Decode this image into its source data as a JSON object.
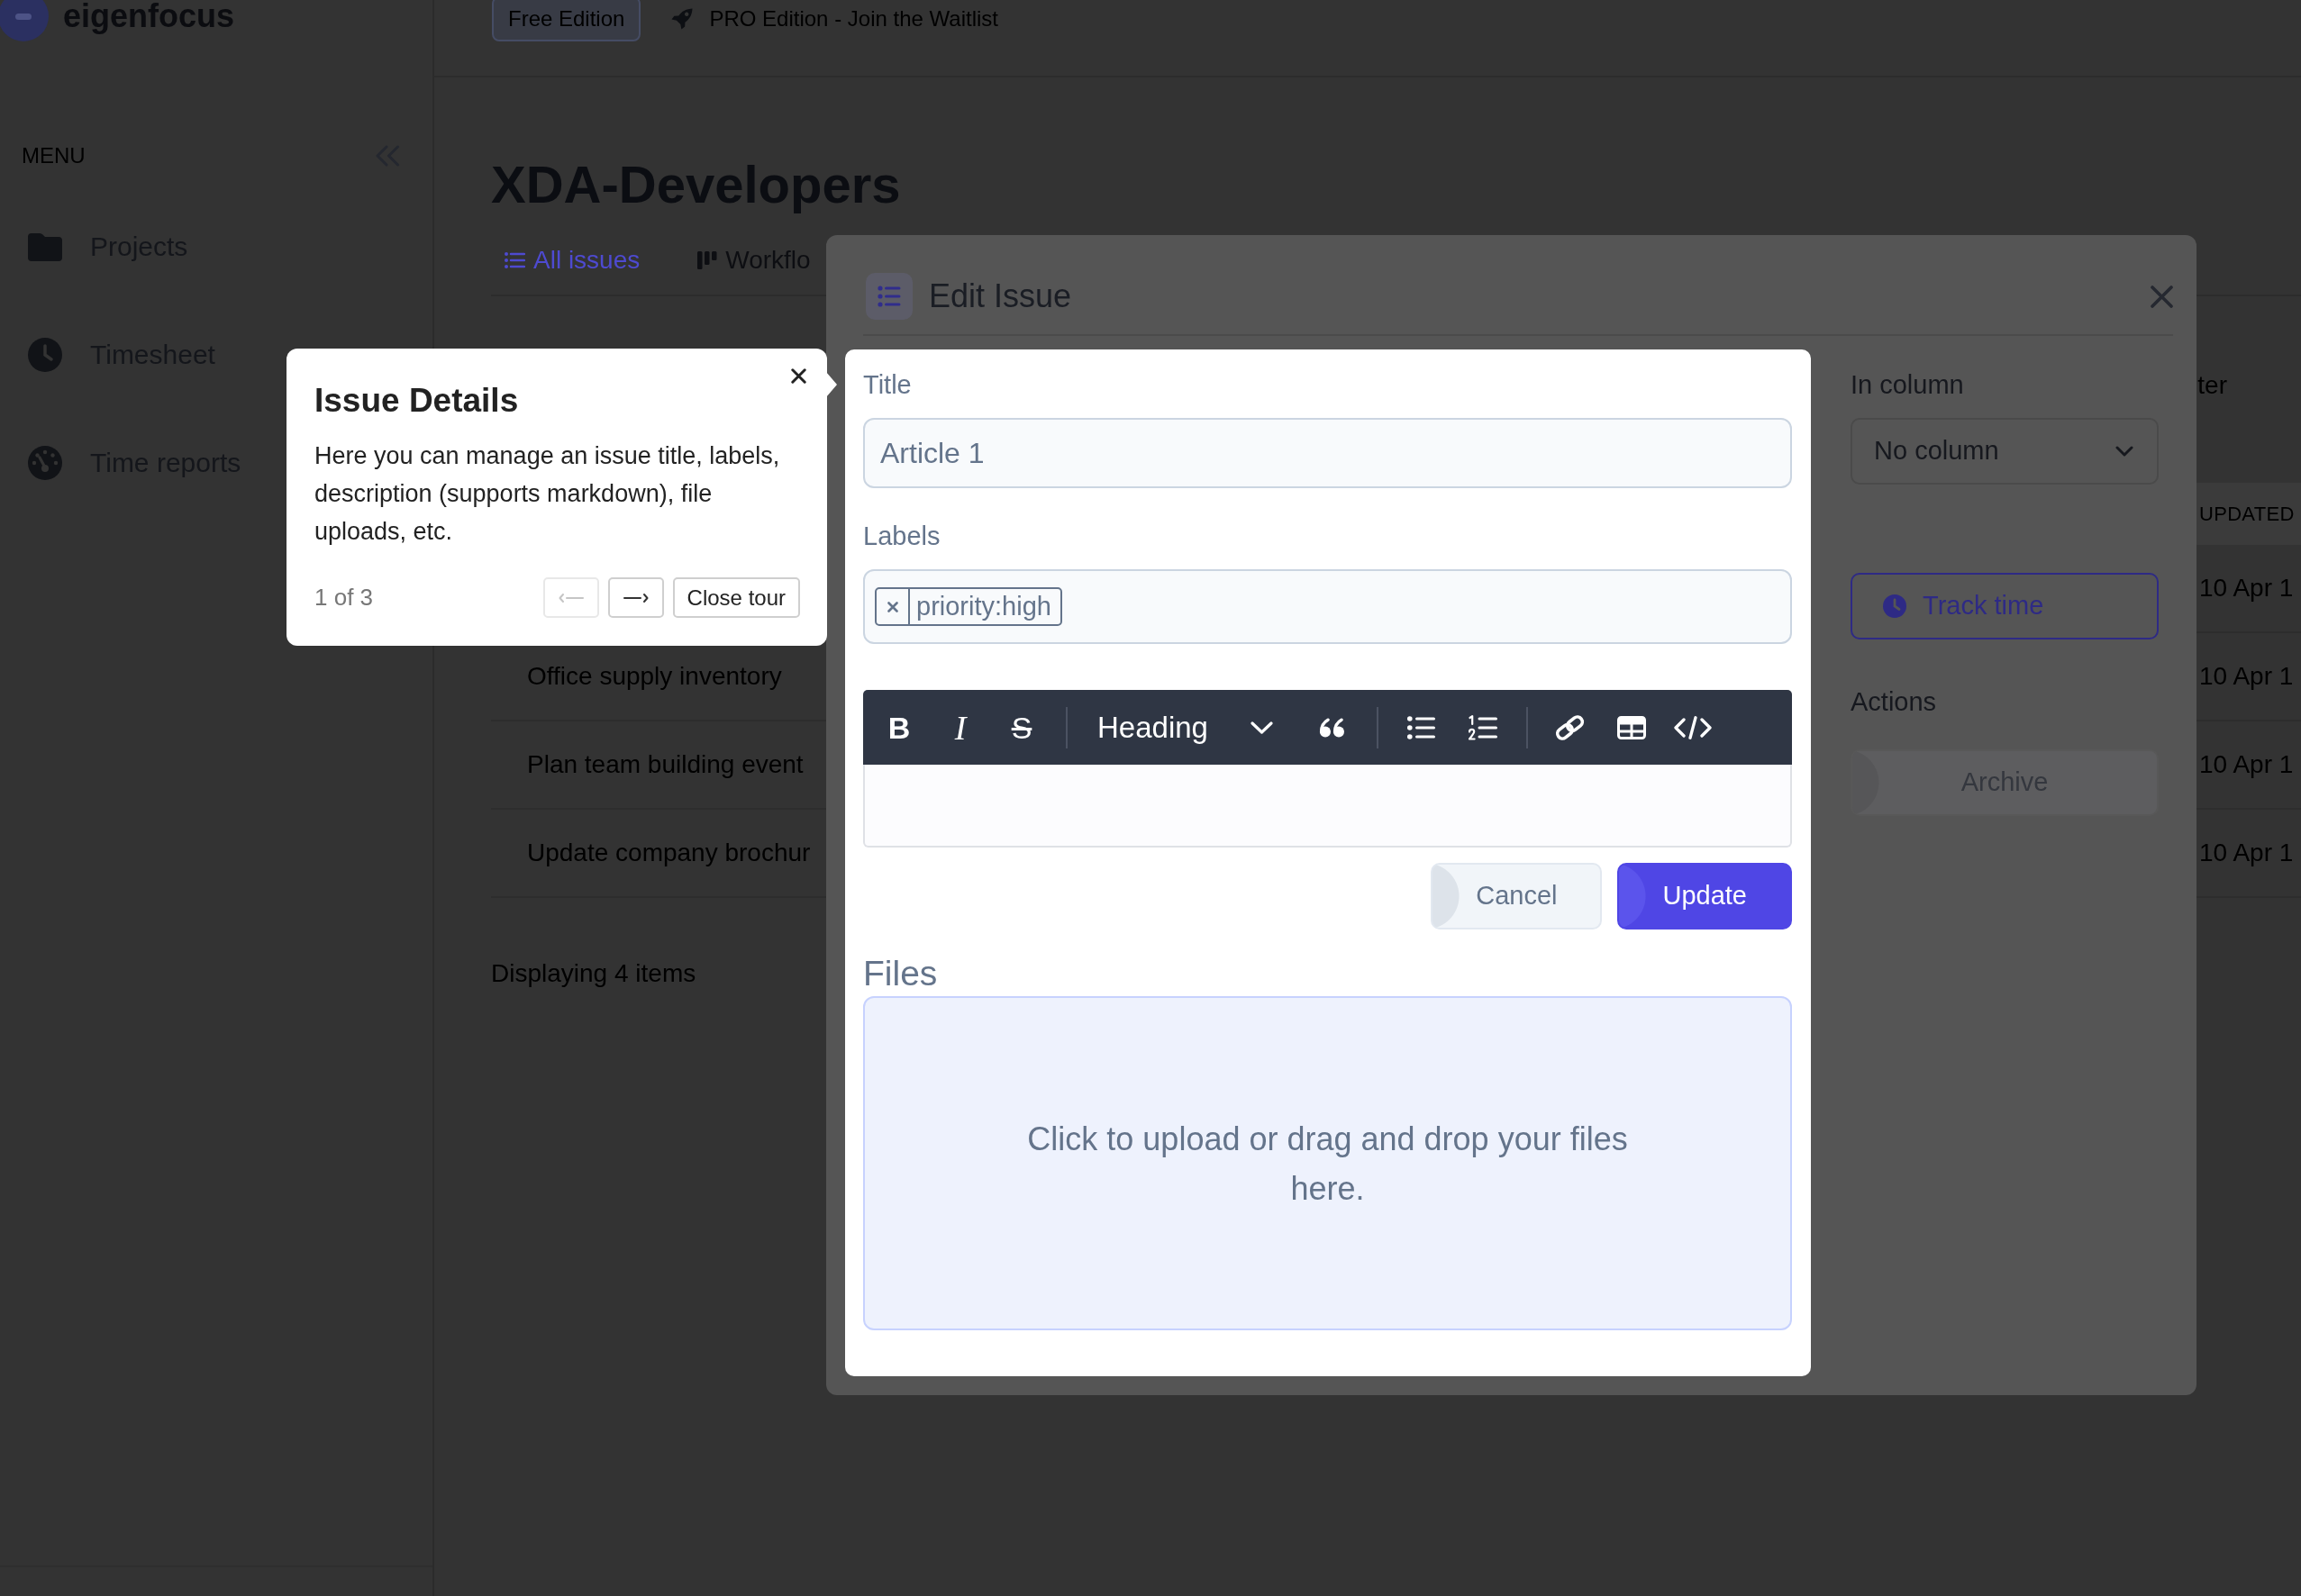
{
  "sidebar": {
    "brand": "eigenfocus",
    "menu_heading": "MENU",
    "items": [
      {
        "label": "Projects",
        "selected": false
      },
      {
        "label": "Timesheet",
        "selected": false
      },
      {
        "label": "Time reports",
        "selected": false
      }
    ]
  },
  "header": {
    "edition_badge": "Free Edition",
    "waitlist_link": "PRO Edition - Join the Waitlist"
  },
  "page": {
    "title": "XDA-Developers",
    "tabs": [
      {
        "label": "All issues",
        "selected": true
      },
      {
        "label": "Workflo",
        "selected": false
      }
    ],
    "toolbar_fragment": "ter",
    "table": {
      "columns": [
        "UPDATED"
      ],
      "rows": [
        {
          "updated": "10 Apr 1"
        },
        {
          "column_1": "Office supply inventory",
          "updated": "10 Apr 1"
        },
        {
          "column_1": "Plan team building event",
          "updated": "10 Apr 1"
        },
        {
          "column_1": "Update company brochur",
          "updated": "10 Apr 1"
        }
      ]
    },
    "footer": "Displaying 4 items"
  },
  "modal": {
    "title": "Edit Issue",
    "title_field": {
      "label": "Title",
      "value": "Article 1"
    },
    "labels_field": {
      "label": "Labels",
      "tags": [
        {
          "text": "priority:high"
        }
      ]
    },
    "editor": {
      "bold": "B",
      "italic": "I",
      "strikethrough": "S",
      "heading": "Heading"
    },
    "buttons": [
      {
        "label": "Cancel",
        "kind": "secondary"
      },
      {
        "label": "Update",
        "kind": "primary"
      }
    ],
    "files": {
      "heading": "Files",
      "dropzone": "Click to upload or drag and drop your files here."
    },
    "side": {
      "column_field": {
        "label": "In column",
        "value": "No column"
      },
      "track_time": "Track time",
      "actions_heading": "Actions",
      "archive": "Archive"
    }
  },
  "tour": {
    "title": "Issue Details",
    "body": "Here you can manage an issue title, labels, description (supports markdown), file uploads, etc.",
    "progress": "1 of 3",
    "back": {
      "disabled": true
    },
    "next": {
      "disabled": false
    },
    "close_label": "Close tour"
  }
}
